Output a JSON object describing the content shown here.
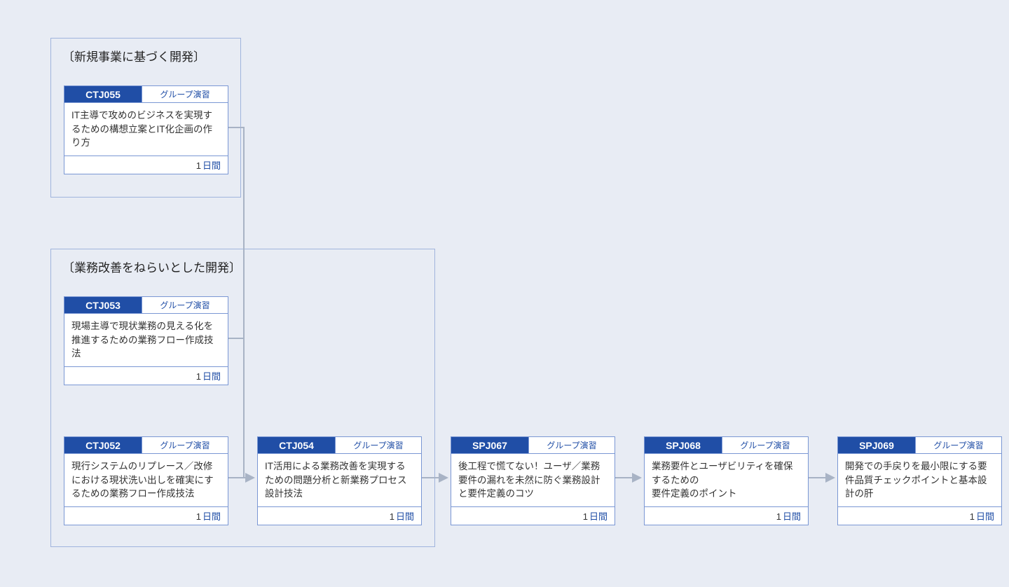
{
  "groups": [
    {
      "title": "〔新規事業に基づく開発〕"
    },
    {
      "title": "〔業務改善をねらいとした開発〕"
    }
  ],
  "cards": {
    "ctj055": {
      "id": "CTJ055",
      "badge": "グループ演習",
      "desc": "IT主導で攻めのビジネスを実現するための構想立案とIT化企画の作り方",
      "dur_num": "1",
      "dur_unit": "日間"
    },
    "ctj053": {
      "id": "CTJ053",
      "badge": "グループ演習",
      "desc": "現場主導で現状業務の見える化を推進するための業務フロー作成技法",
      "dur_num": "1",
      "dur_unit": "日間"
    },
    "ctj052": {
      "id": "CTJ052",
      "badge": "グループ演習",
      "desc": "現行システムのリプレース／改修における現状洗い出しを確実にするための業務フロー作成技法",
      "dur_num": "1",
      "dur_unit": "日間"
    },
    "ctj054": {
      "id": "CTJ054",
      "badge": "グループ演習",
      "desc": "IT活用による業務改善を実現するための問題分析と新業務プロセス設計技法",
      "dur_num": "1",
      "dur_unit": "日間"
    },
    "spj067": {
      "id": "SPJ067",
      "badge": "グループ演習",
      "desc": "後工程で慌てない！ユーザ／業務要件の漏れを未然に防ぐ業務設計と要件定義のコツ",
      "dur_num": "1",
      "dur_unit": "日間"
    },
    "spj068": {
      "id": "SPJ068",
      "badge": "グループ演習",
      "desc": "業務要件とユーザビリティを確保するための\n要件定義のポイント",
      "dur_num": "1",
      "dur_unit": "日間"
    },
    "spj069": {
      "id": "SPJ069",
      "badge": "グループ演習",
      "desc": "開発での手戻りを最小限にする要件品質チェックポイントと基本設計の肝",
      "dur_num": "1",
      "dur_unit": "日間"
    }
  }
}
